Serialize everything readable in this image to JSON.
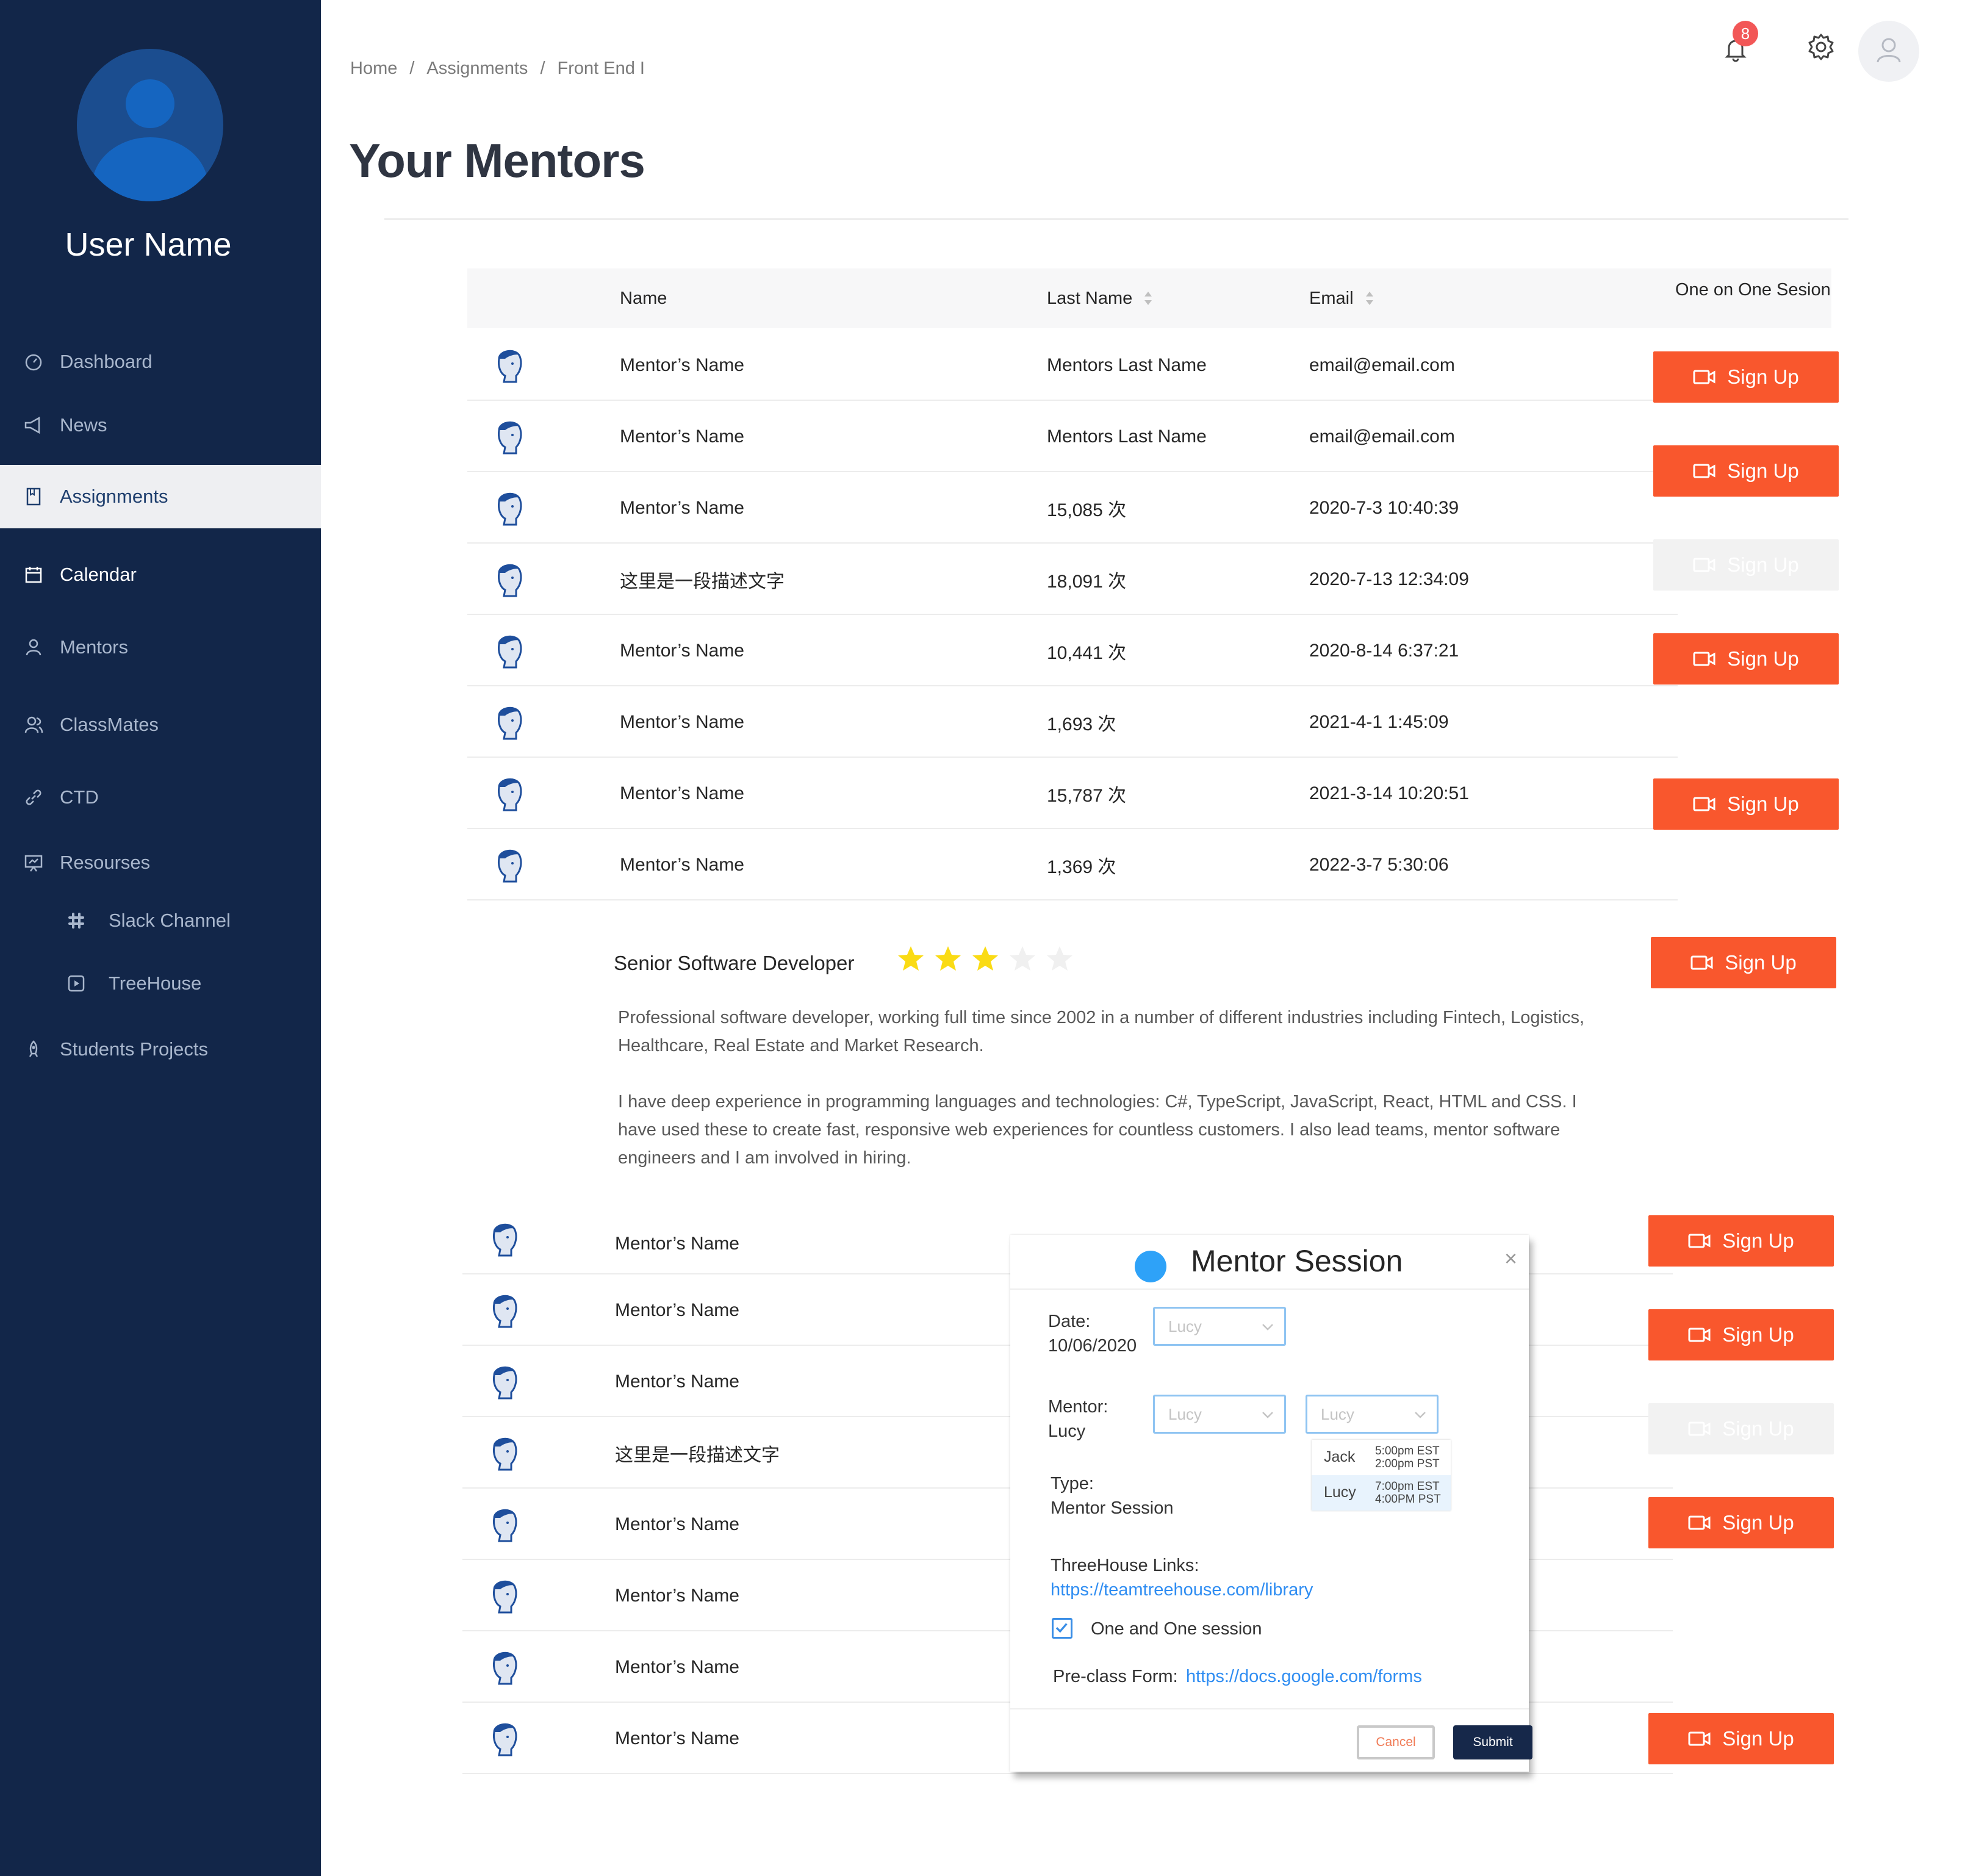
{
  "user": {
    "name": "User Name"
  },
  "sidebar": {
    "items": [
      {
        "label": "Dashboard",
        "icon": "dashboard-icon"
      },
      {
        "label": "News",
        "icon": "megaphone-icon"
      },
      {
        "label": "Assignments",
        "icon": "bookmark-icon",
        "active": true
      },
      {
        "label": "Calendar",
        "icon": "calendar-icon"
      },
      {
        "label": "Mentors",
        "icon": "person-icon"
      },
      {
        "label": "ClassMates",
        "icon": "people-icon"
      },
      {
        "label": "CTD",
        "icon": "link-icon"
      },
      {
        "label": "Resourses",
        "icon": "presentation-icon"
      },
      {
        "label": "Slack Channel",
        "icon": "slack-icon"
      },
      {
        "label": "TreeHouse",
        "icon": "play-square-icon"
      },
      {
        "label": "Students Projects",
        "icon": "rocket-icon"
      }
    ]
  },
  "header": {
    "breadcrumb": [
      "Home",
      "/",
      "Assignments",
      "/",
      "Front End I"
    ],
    "notification_count": "8"
  },
  "page": {
    "title": "Your Mentors"
  },
  "table": {
    "headers": {
      "name": "Name",
      "last_name": "Last Name",
      "email": "Email",
      "session": "One on One Sesion"
    },
    "rows": [
      {
        "name": "Mentor’s Name",
        "last": "Mentors Last Name",
        "email": "email@email.com"
      },
      {
        "name": "Mentor’s Name",
        "last": "Mentors Last Name",
        "email": "email@email.com"
      },
      {
        "name": "Mentor’s Name",
        "last": "15,085 次",
        "email": "2020-7-3 10:40:39"
      },
      {
        "name": "这里是一段描述文字",
        "last": "18,091 次",
        "email": "2020-7-13 12:34:09"
      },
      {
        "name": "Mentor’s Name",
        "last": "10,441 次",
        "email": "2020-8-14 6:37:21"
      },
      {
        "name": "Mentor’s Name",
        "last": "1,693 次",
        "email": "2021-4-1 1:45:09"
      },
      {
        "name": "Mentor’s Name",
        "last": "15,787 次",
        "email": "2021-3-14 10:20:51"
      },
      {
        "name": "Mentor’s Name",
        "last": "1,369 次",
        "email": "2022-3-7 5:30:06"
      }
    ],
    "rows2": [
      {
        "name": "Mentor’s Name"
      },
      {
        "name": "Mentor’s Name"
      },
      {
        "name": "Mentor’s Name"
      },
      {
        "name": "这里是一段描述文字"
      },
      {
        "name": "Mentor’s Name"
      },
      {
        "name": "Mentor’s Name"
      },
      {
        "name": "Mentor’s Name"
      },
      {
        "name": "Mentor’s Name"
      }
    ],
    "signup_label": "Sign Up"
  },
  "detail": {
    "title": "Senior Software Developer",
    "rating": 3,
    "rating_max": 5,
    "para1": "Professional software developer, working full time since 2002 in a number of different industries including Fintech, Logistics, Healthcare, Real Estate and Market Research.",
    "para2": "I have deep experience in programming languages and technologies: C#, TypeScript, JavaScript, React, HTML and CSS. I have used these to create fast, responsive web experiences for countless customers. I also lead teams, mentor software engineers and I am involved in hiring."
  },
  "modal": {
    "title": "Mentor Session",
    "close": "×",
    "date_label": "Date:",
    "date_value": "10/06/2020",
    "mentor_label": "Mentor:",
    "mentor_value": "Lucy",
    "type_label": "Type:",
    "type_value": "Mentor Session",
    "select_placeholder": "Lucy",
    "dropdown": [
      {
        "name": "Jack",
        "t1": "5:00pm EST",
        "t2": "2:00pm PST"
      },
      {
        "name": "Lucy",
        "t1": "7:00pm EST",
        "t2": "4:00PM PST"
      }
    ],
    "links_label": "ThreeHouse Links:",
    "links_url": "https://teamtreehouse.com/library",
    "checkbox_label": "One and One session",
    "checkbox_checked": true,
    "preclass_label": "Pre-class Form:",
    "preclass_url": "https://docs.google.com/forms",
    "cancel": "Cancel",
    "submit": "Submit"
  },
  "colors": {
    "sidebar": "#122649",
    "accent": "#f9572d",
    "link": "#2f8df2",
    "star": "#fadb14"
  }
}
